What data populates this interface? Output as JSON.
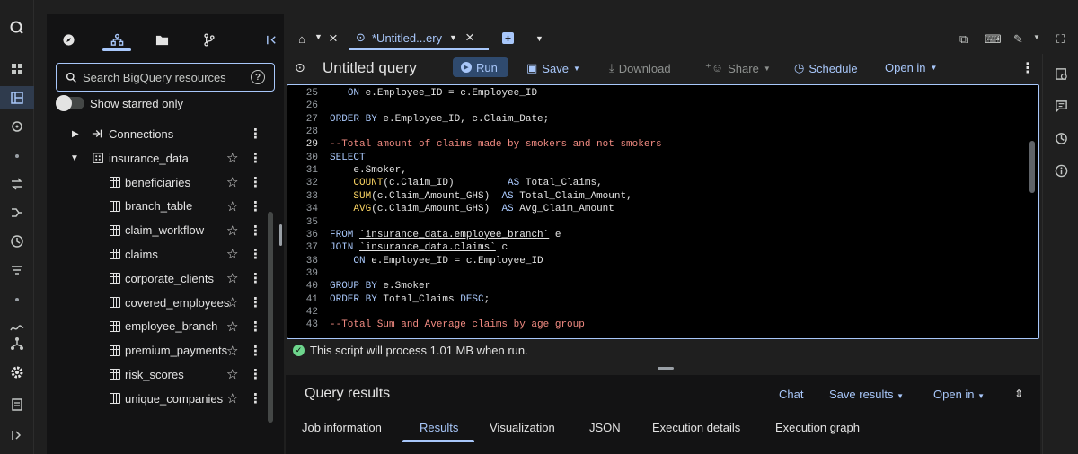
{
  "explorer": {
    "search_placeholder": "Search BigQuery resources",
    "starred_label": "Show starred only",
    "connections_label": "Connections",
    "dataset_label": "insurance_data",
    "tables": [
      "beneficiaries",
      "branch_table",
      "claim_workflow",
      "claims",
      "corporate_clients",
      "covered_employees",
      "employee_branch",
      "premium_payments",
      "risk_scores",
      "unique_companies"
    ]
  },
  "tabs": {
    "query_tab_label": "*Untitled...ery"
  },
  "toolbar": {
    "title": "Untitled query",
    "run": "Run",
    "save": "Save",
    "download": "Download",
    "share": "Share",
    "schedule": "Schedule",
    "open_in": "Open in"
  },
  "editor": {
    "current_line": 29,
    "lines": [
      {
        "n": 25,
        "html": "   <span class='kw'>ON</span> e.Employee_ID = c.Employee_ID"
      },
      {
        "n": 26,
        "html": ""
      },
      {
        "n": 27,
        "html": "<span class='kw'>ORDER BY</span> e.Employee_ID, c.Claim_Date;"
      },
      {
        "n": 28,
        "html": ""
      },
      {
        "n": 29,
        "html": "<span class='cm'>--Total amount of claims made by smokers and not smokers</span>"
      },
      {
        "n": 30,
        "html": "<span class='kw'>SELECT</span>"
      },
      {
        "n": 31,
        "html": "    e.Smoker,"
      },
      {
        "n": 32,
        "html": "    <span class='fn'>COUNT</span>(c.Claim_ID)         <span class='kw'>AS</span> Total_Claims,"
      },
      {
        "n": 33,
        "html": "    <span class='fn'>SUM</span>(c.Claim_Amount_GHS)  <span class='kw'>AS</span> Total_Claim_Amount,"
      },
      {
        "n": 34,
        "html": "    <span class='fn'>AVG</span>(c.Claim_Amount_GHS)  <span class='kw'>AS</span> Avg_Claim_Amount"
      },
      {
        "n": 35,
        "html": ""
      },
      {
        "n": 36,
        "html": "<span class='kw'>FROM</span> <span class='str'>`insurance_data.employee_branch`</span> e"
      },
      {
        "n": 37,
        "html": "<span class='kw'>JOIN</span> <span class='str'>`insurance_data.claims`</span> c"
      },
      {
        "n": 38,
        "html": "    <span class='kw'>ON</span> e.Employee_ID = c.Employee_ID"
      },
      {
        "n": 39,
        "html": ""
      },
      {
        "n": 40,
        "html": "<span class='kw'>GROUP BY</span> e.Smoker"
      },
      {
        "n": 41,
        "html": "<span class='kw'>ORDER BY</span> Total_Claims <span class='kw'>DESC</span>;"
      },
      {
        "n": 42,
        "html": ""
      },
      {
        "n": 43,
        "html": "<span class='cm'>--Total Sum and Average claims by age group</span>"
      }
    ]
  },
  "status": {
    "message": "This script will process 1.01 MB when run."
  },
  "results": {
    "title": "Query results",
    "chat": "Chat",
    "save_results": "Save results",
    "open_in": "Open in",
    "tabs": [
      "Job information",
      "Results",
      "Visualization",
      "JSON",
      "Execution details",
      "Execution graph"
    ],
    "active_tab": "Results"
  },
  "colors": {
    "accent": "#a8c7fa",
    "keyword": "#a8c7fa",
    "function": "#fdd663",
    "comment": "#f28b82",
    "success": "#6dd58c"
  }
}
